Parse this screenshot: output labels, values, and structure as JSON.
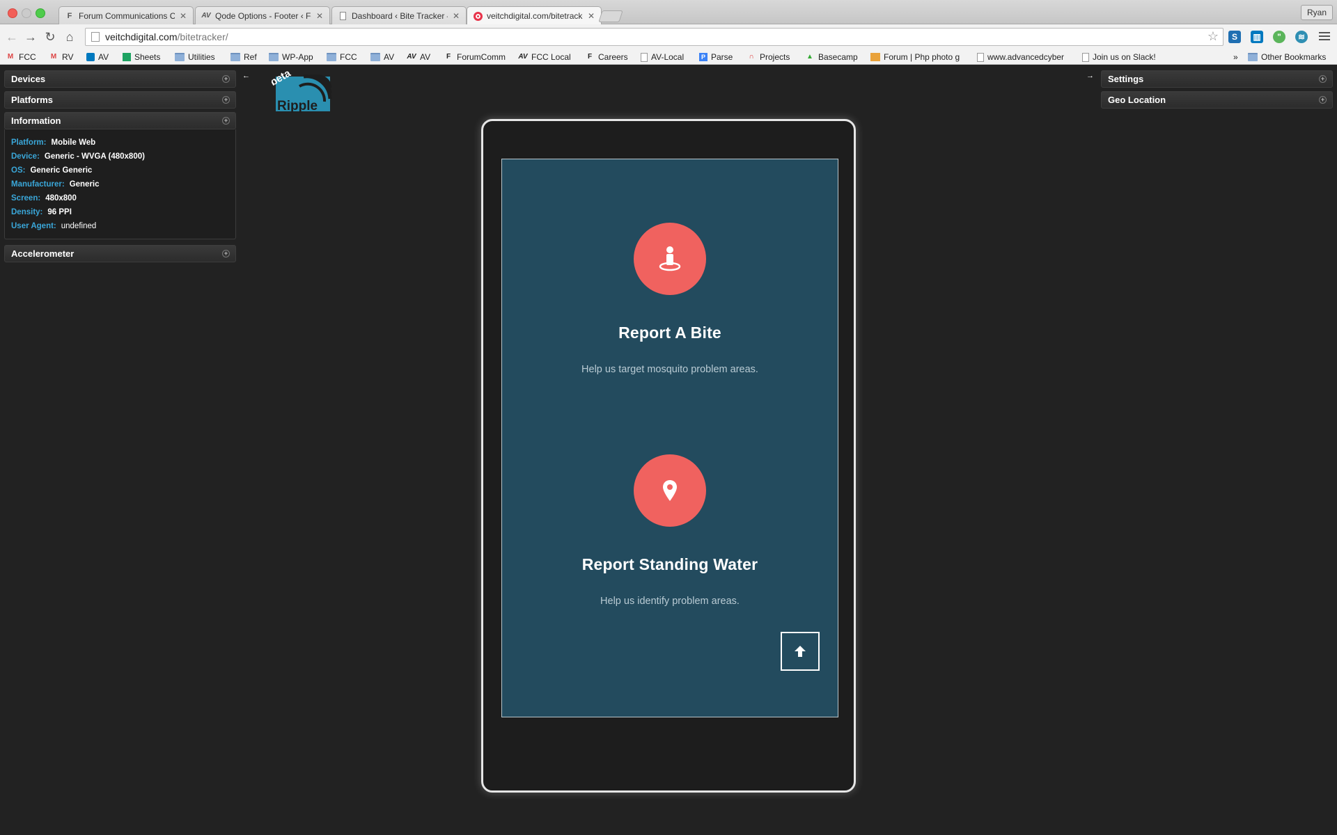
{
  "browser": {
    "tabs": [
      {
        "title": "Forum Communications Co",
        "icon": "forum-icon"
      },
      {
        "title": "Qode Options - Footer ‹ For",
        "icon": "av-icon"
      },
      {
        "title": "Dashboard ‹ Bite Tracker —",
        "icon": "page-icon"
      },
      {
        "title": "veitchdigital.com/bitetracker",
        "icon": "ripple-icon"
      }
    ],
    "profile_name": "Ryan",
    "url_host": "veitchdigital.com",
    "url_path": "/bitetracker/",
    "bookmarks": [
      {
        "label": "FCC",
        "icon": "gmail"
      },
      {
        "label": "RV",
        "icon": "gmail"
      },
      {
        "label": "AV",
        "icon": "trello"
      },
      {
        "label": "Sheets",
        "icon": "sheet"
      },
      {
        "label": "Utilities",
        "icon": "folder"
      },
      {
        "label": "Ref",
        "icon": "folder"
      },
      {
        "label": "WP-App",
        "icon": "folder"
      },
      {
        "label": "FCC",
        "icon": "folder"
      },
      {
        "label": "AV",
        "icon": "folder"
      },
      {
        "label": "AV",
        "icon": "av"
      },
      {
        "label": "ForumComm",
        "icon": "forum"
      },
      {
        "label": "FCC Local",
        "icon": "av"
      },
      {
        "label": "Careers",
        "icon": "forum"
      },
      {
        "label": "AV-Local",
        "icon": "page"
      },
      {
        "label": "Parse",
        "icon": "parse"
      },
      {
        "label": "Projects",
        "icon": "projects"
      },
      {
        "label": "Basecamp",
        "icon": "basecamp"
      },
      {
        "label": "Forum | Php photo g",
        "icon": "photo"
      },
      {
        "label": "www.advancedcyber",
        "icon": "page"
      },
      {
        "label": "Join us on Slack!",
        "icon": "page"
      }
    ],
    "bookmarks_overflow": "»",
    "other_bookmarks": "Other Bookmarks"
  },
  "ripple": {
    "left_panels": {
      "devices": "Devices",
      "platforms": "Platforms",
      "information": "Information",
      "accelerometer": "Accelerometer"
    },
    "info": {
      "platform_label": "Platform:",
      "platform": "Mobile Web",
      "device_label": "Device:",
      "device": "Generic - WVGA (480x800)",
      "os_label": "OS:",
      "os": "Generic Generic",
      "manufacturer_label": "Manufacturer:",
      "manufacturer": "Generic",
      "screen_label": "Screen:",
      "screen": "480x800",
      "density_label": "Density:",
      "density": "96 PPI",
      "user_agent_label": "User Agent:",
      "user_agent": "undefined"
    },
    "right_panels": {
      "settings": "Settings",
      "geo_location": "Geo Location"
    },
    "logo_text": "Ripple",
    "logo_badge": "beta"
  },
  "app": {
    "actions": [
      {
        "title": "Report A Bite",
        "description": "Help us target mosquito problem areas.",
        "icon": "person-pin-icon"
      },
      {
        "title": "Report Standing Water",
        "description": "Help us identify problem areas.",
        "icon": "map-pin-icon"
      }
    ],
    "colors": {
      "screen_bg": "#234b5e",
      "accent_circle": "#f0625f",
      "info_label": "#3aa7d9"
    }
  }
}
